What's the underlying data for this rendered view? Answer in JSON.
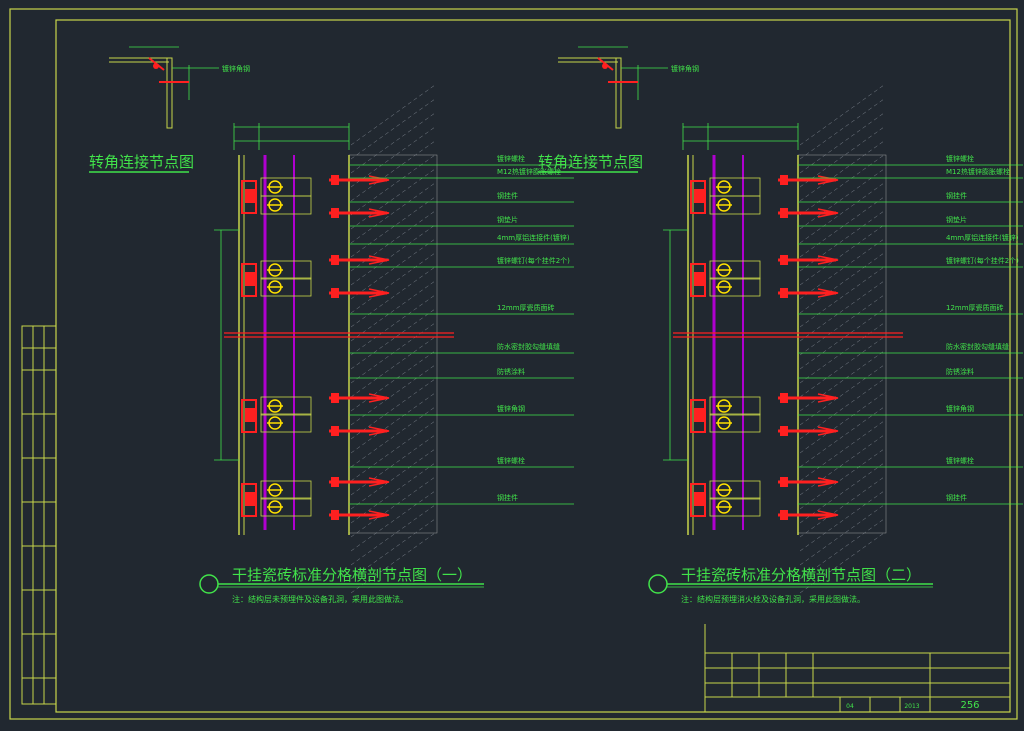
{
  "sheet": {
    "number": "256",
    "title_block_small": [
      "04",
      "2013"
    ]
  },
  "corner_detail": {
    "title": "转角连接节点图",
    "callout": "镀锌角钢"
  },
  "sections": [
    {
      "title": "干挂瓷砖标准分格横剖节点图（一）",
      "note": "注：结构层未预埋件及设备孔洞，采用此图做法。"
    },
    {
      "title": "干挂瓷砖标准分格横剖节点图（二）",
      "note": "注：结构层预埋消火栓及设备孔洞，采用此图做法。"
    }
  ],
  "callouts": [
    "镀锌螺栓",
    "M12热镀锌膨胀螺栓",
    "钢挂件",
    "钢垫片",
    "4mm厚铝连接件(镀锌)",
    "镀锌螺钉(每个挂件2个)",
    "12mm厚瓷质面砖",
    "防水密封胶勾缝填缝",
    "防锈涂料",
    "镀锌角钢",
    "镀锌螺栓",
    "钢挂件"
  ],
  "colors": {
    "background": "#212830",
    "frame": "#c8d64a",
    "text": "#41e34a",
    "anchor": "#ff2020",
    "clip": "#ffe100",
    "stud": "#b000d0",
    "hatch": "#a0a0a0"
  }
}
